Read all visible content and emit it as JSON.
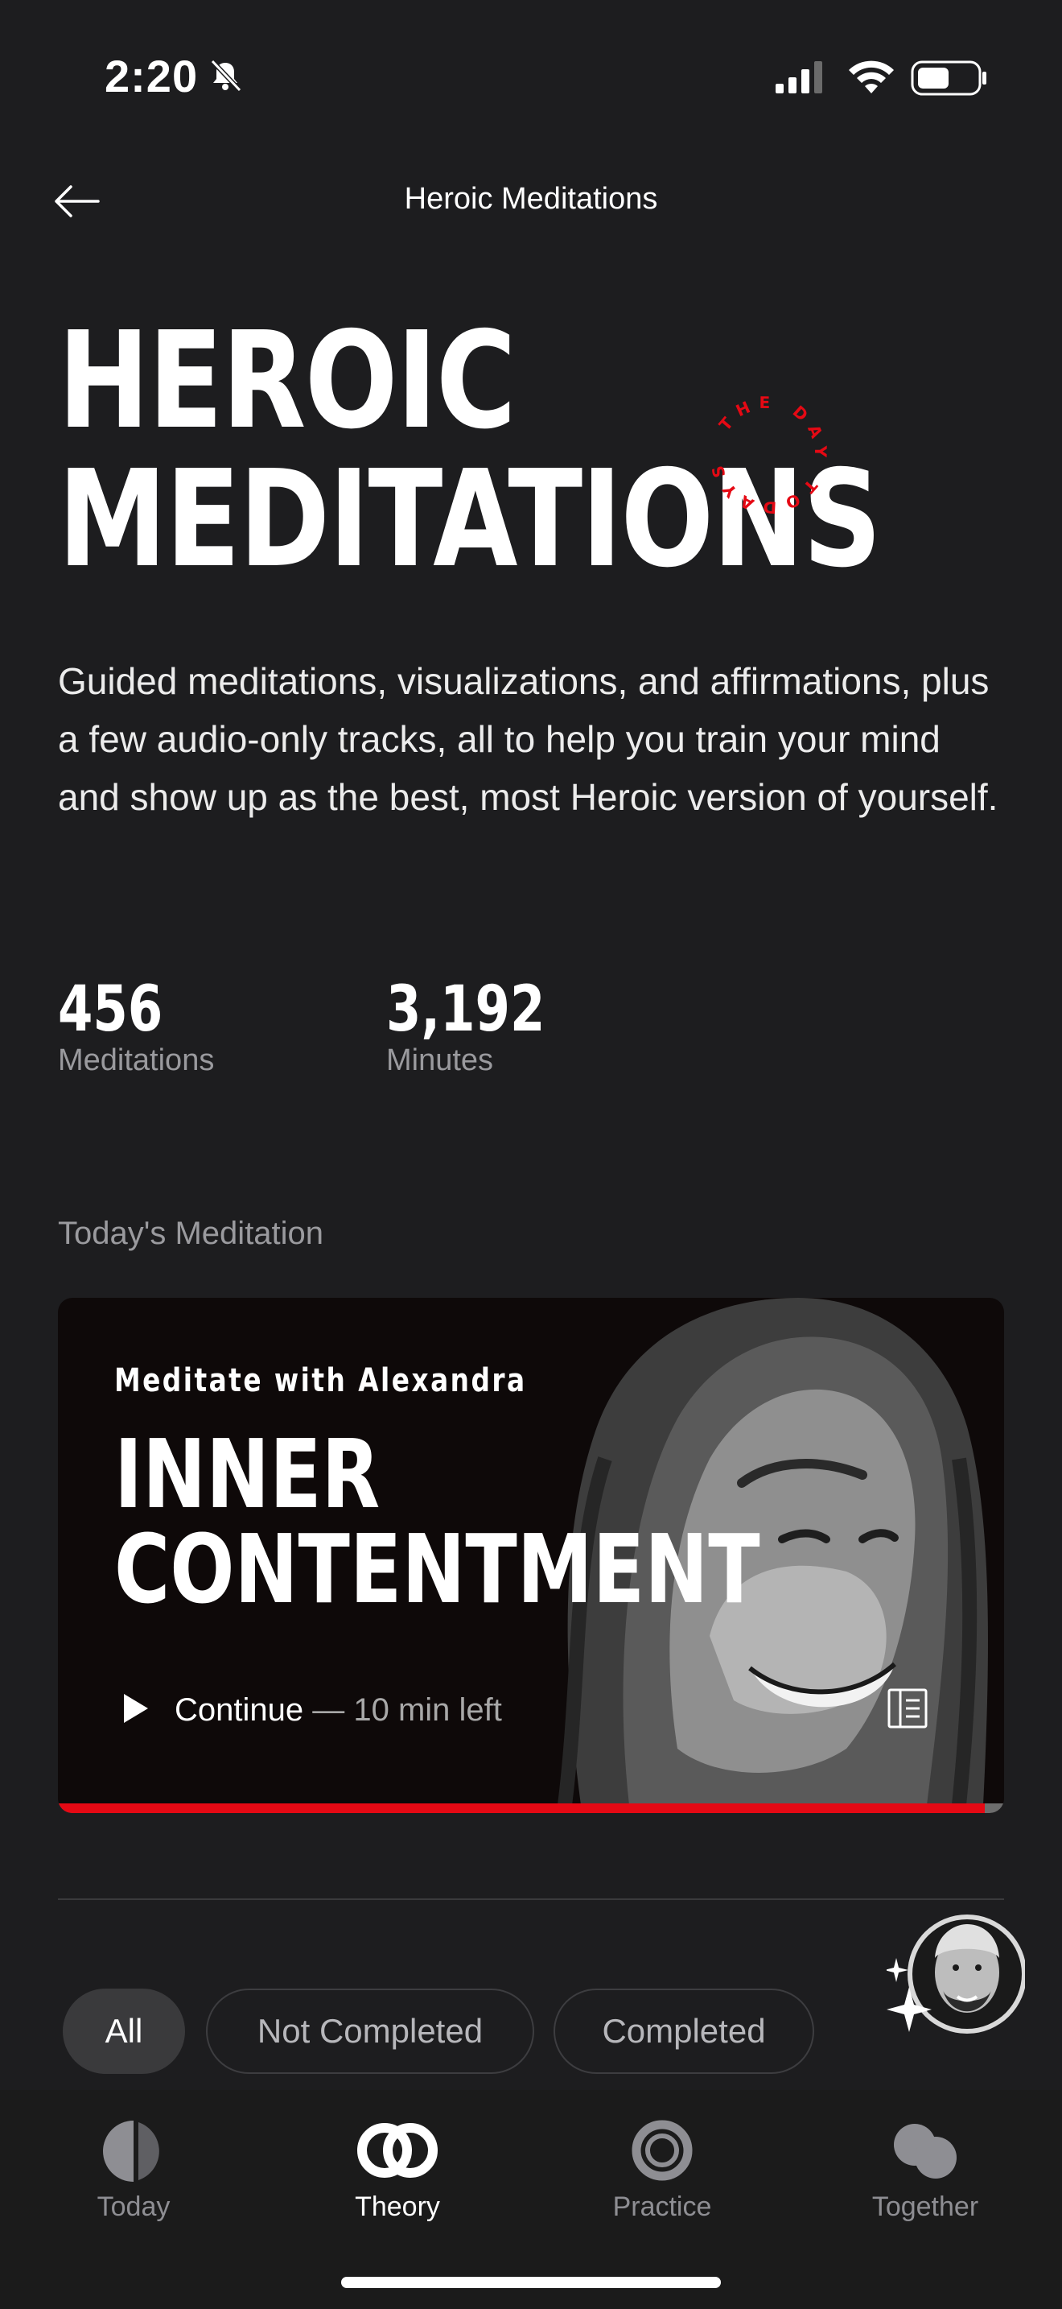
{
  "status_bar": {
    "time": "2:20"
  },
  "header": {
    "title": "Heroic Meditations"
  },
  "hero": {
    "title_line1": "HEROIC",
    "title_line2": "MEDITATIONS",
    "badge_text": "THE DAY TODAYS",
    "description": "Guided meditations, visualizations, and affirmations, plus a few audio-only tracks, all to help you train your mind and show up as the best, most Heroic version of yourself."
  },
  "stats": [
    {
      "value": "456",
      "label": "Meditations"
    },
    {
      "value": "3,192",
      "label": "Minutes"
    }
  ],
  "todays_meditation": {
    "section_label": "Today's Meditation",
    "kicker": "Meditate with Alexandra",
    "title_line1": "INNER",
    "title_line2": "CONTENTMENT",
    "continue_label": "Continue",
    "time_left": " — 10 min left",
    "progress": 0.98
  },
  "filters": [
    {
      "label": "All",
      "active": true
    },
    {
      "label": "Not Completed",
      "active": false
    },
    {
      "label": "Completed",
      "active": false
    }
  ],
  "tabs": [
    {
      "label": "Today",
      "icon": "today-icon",
      "active": false
    },
    {
      "label": "Theory",
      "icon": "theory-icon",
      "active": true
    },
    {
      "label": "Practice",
      "icon": "practice-icon",
      "active": false
    },
    {
      "label": "Together",
      "icon": "together-icon",
      "active": false
    }
  ],
  "colors": {
    "accent": "#e50914",
    "background": "#1d1d1f",
    "muted_text": "#9a9a9e"
  }
}
